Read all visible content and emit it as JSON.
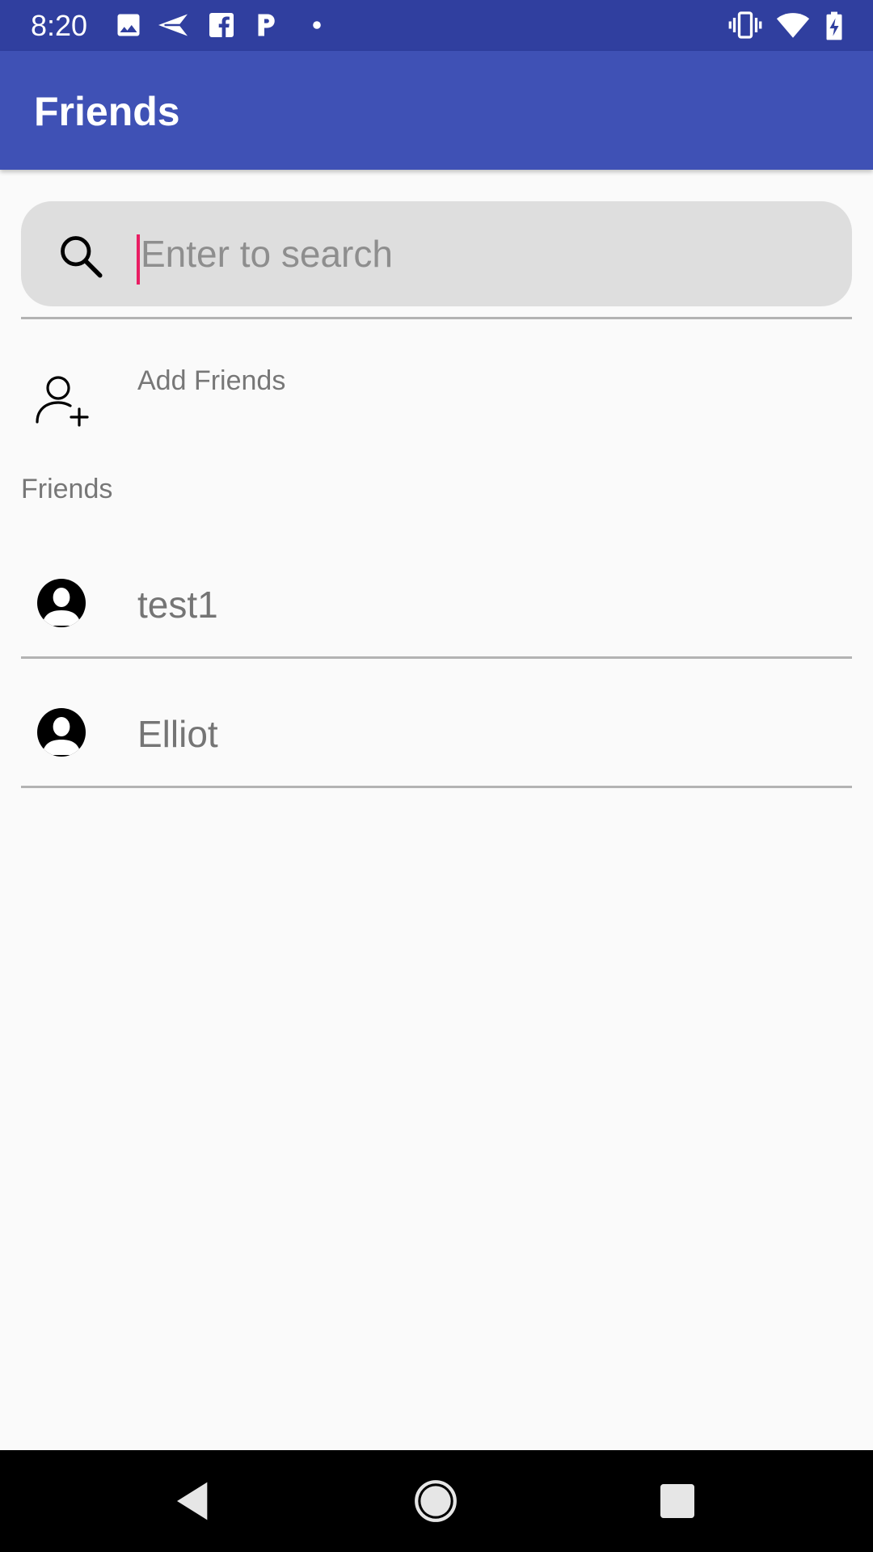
{
  "status_bar": {
    "time": "8:20",
    "left_icons": [
      "image-icon",
      "send-icon",
      "facebook-icon",
      "pandora-icon",
      "notification-dot-icon"
    ],
    "right_icons": [
      "vibrate-icon",
      "wifi-icon",
      "battery-charging-icon"
    ]
  },
  "app_bar": {
    "title": "Friends"
  },
  "search": {
    "placeholder": "Enter to search",
    "value": "",
    "icon": "search-icon"
  },
  "add_friends": {
    "label": "Add Friends",
    "icon": "add-person-icon"
  },
  "friends_section": {
    "header": "Friends",
    "items": [
      {
        "name": "test1",
        "icon": "account-circle-icon"
      },
      {
        "name": "Elliot",
        "icon": "account-circle-icon"
      }
    ]
  },
  "nav_bar": {
    "buttons": [
      "back-icon",
      "home-icon",
      "recents-icon"
    ]
  },
  "colors": {
    "status_bar": "#303f9f",
    "app_bar": "#3f51b5",
    "caret": "#e91e63",
    "background": "#fafafa",
    "search_fill": "#dedede"
  }
}
